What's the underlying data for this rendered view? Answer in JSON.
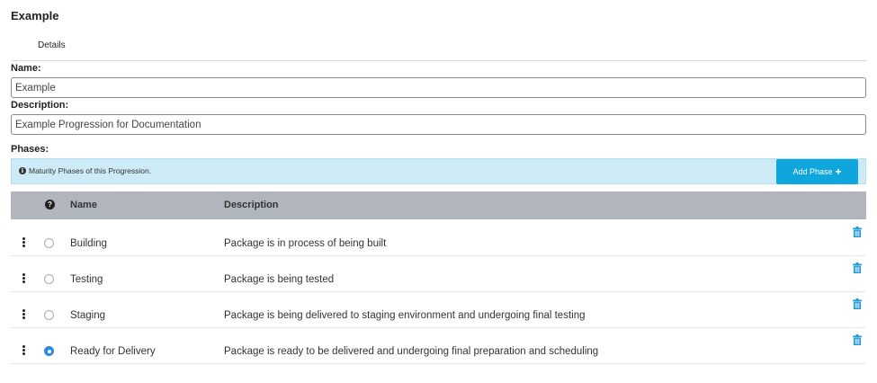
{
  "page": {
    "title": "Example"
  },
  "tabs": [
    {
      "label": "Details"
    }
  ],
  "form": {
    "name": {
      "label": "Name:",
      "value": "Example"
    },
    "description": {
      "label": "Description:",
      "value": "Example Progression for Documentation"
    },
    "phases_label": "Phases:"
  },
  "info": {
    "text": "Maturity Phases of this Progression.",
    "icon": "info-icon"
  },
  "add_phase": {
    "label": "Add Phase",
    "icon": "plus-icon"
  },
  "table": {
    "headers": {
      "help_icon": "question-icon",
      "name": "Name",
      "description": "Description"
    },
    "rows": [
      {
        "name": "Building",
        "description": "Package is in process of being built",
        "selected": false
      },
      {
        "name": "Testing",
        "description": "Package is being tested",
        "selected": false
      },
      {
        "name": "Staging",
        "description": "Package is being delivered to staging environment and undergoing final testing",
        "selected": false
      },
      {
        "name": "Ready for Delivery",
        "description": "Package is ready to be delivered and undergoing final preparation and scheduling",
        "selected": true
      }
    ]
  },
  "colors": {
    "accent": "#0ea6dc",
    "info_bg": "#cdebf7",
    "header_bg": "#b1b5bd",
    "radio_checked": "#2a8ae0",
    "trash": "#1a9bd7"
  }
}
